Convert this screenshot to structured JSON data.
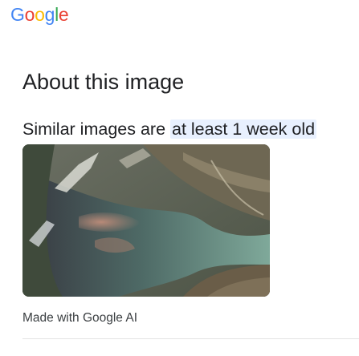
{
  "logo": {
    "text": "Google",
    "letters": [
      "G",
      "o",
      "o",
      "g",
      "l",
      "e"
    ],
    "colors": [
      "#4285F4",
      "#EA4335",
      "#FBBC05",
      "#4285F4",
      "#34A853",
      "#EA4335"
    ]
  },
  "page": {
    "title": "About this image",
    "subtitle_prefix": "Similar images are ",
    "subtitle_highlight": "at least 1 week old",
    "caption": "Made with Google AI"
  },
  "image": {
    "description_icon": "aerial-river-landscape-image"
  },
  "colors": {
    "highlight_bg": "#e8f0fe",
    "text_primary": "#202124",
    "text_secondary": "#3c4043"
  }
}
